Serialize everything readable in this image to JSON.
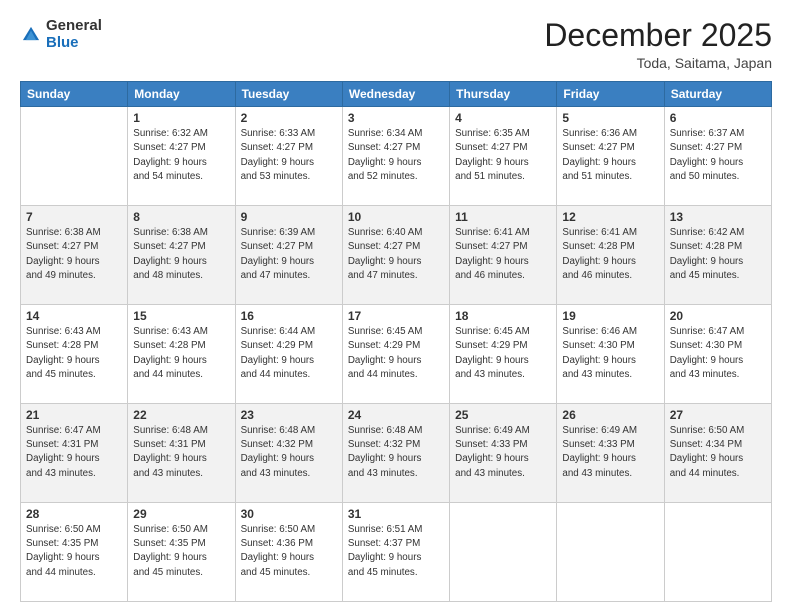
{
  "logo": {
    "general": "General",
    "blue": "Blue"
  },
  "title": "December 2025",
  "location": "Toda, Saitama, Japan",
  "weekdays": [
    "Sunday",
    "Monday",
    "Tuesday",
    "Wednesday",
    "Thursday",
    "Friday",
    "Saturday"
  ],
  "weeks": [
    [
      {
        "day": "",
        "info": ""
      },
      {
        "day": "1",
        "info": "Sunrise: 6:32 AM\nSunset: 4:27 PM\nDaylight: 9 hours\nand 54 minutes."
      },
      {
        "day": "2",
        "info": "Sunrise: 6:33 AM\nSunset: 4:27 PM\nDaylight: 9 hours\nand 53 minutes."
      },
      {
        "day": "3",
        "info": "Sunrise: 6:34 AM\nSunset: 4:27 PM\nDaylight: 9 hours\nand 52 minutes."
      },
      {
        "day": "4",
        "info": "Sunrise: 6:35 AM\nSunset: 4:27 PM\nDaylight: 9 hours\nand 51 minutes."
      },
      {
        "day": "5",
        "info": "Sunrise: 6:36 AM\nSunset: 4:27 PM\nDaylight: 9 hours\nand 51 minutes."
      },
      {
        "day": "6",
        "info": "Sunrise: 6:37 AM\nSunset: 4:27 PM\nDaylight: 9 hours\nand 50 minutes."
      }
    ],
    [
      {
        "day": "7",
        "info": "Sunrise: 6:38 AM\nSunset: 4:27 PM\nDaylight: 9 hours\nand 49 minutes."
      },
      {
        "day": "8",
        "info": "Sunrise: 6:38 AM\nSunset: 4:27 PM\nDaylight: 9 hours\nand 48 minutes."
      },
      {
        "day": "9",
        "info": "Sunrise: 6:39 AM\nSunset: 4:27 PM\nDaylight: 9 hours\nand 47 minutes."
      },
      {
        "day": "10",
        "info": "Sunrise: 6:40 AM\nSunset: 4:27 PM\nDaylight: 9 hours\nand 47 minutes."
      },
      {
        "day": "11",
        "info": "Sunrise: 6:41 AM\nSunset: 4:27 PM\nDaylight: 9 hours\nand 46 minutes."
      },
      {
        "day": "12",
        "info": "Sunrise: 6:41 AM\nSunset: 4:28 PM\nDaylight: 9 hours\nand 46 minutes."
      },
      {
        "day": "13",
        "info": "Sunrise: 6:42 AM\nSunset: 4:28 PM\nDaylight: 9 hours\nand 45 minutes."
      }
    ],
    [
      {
        "day": "14",
        "info": "Sunrise: 6:43 AM\nSunset: 4:28 PM\nDaylight: 9 hours\nand 45 minutes."
      },
      {
        "day": "15",
        "info": "Sunrise: 6:43 AM\nSunset: 4:28 PM\nDaylight: 9 hours\nand 44 minutes."
      },
      {
        "day": "16",
        "info": "Sunrise: 6:44 AM\nSunset: 4:29 PM\nDaylight: 9 hours\nand 44 minutes."
      },
      {
        "day": "17",
        "info": "Sunrise: 6:45 AM\nSunset: 4:29 PM\nDaylight: 9 hours\nand 44 minutes."
      },
      {
        "day": "18",
        "info": "Sunrise: 6:45 AM\nSunset: 4:29 PM\nDaylight: 9 hours\nand 43 minutes."
      },
      {
        "day": "19",
        "info": "Sunrise: 6:46 AM\nSunset: 4:30 PM\nDaylight: 9 hours\nand 43 minutes."
      },
      {
        "day": "20",
        "info": "Sunrise: 6:47 AM\nSunset: 4:30 PM\nDaylight: 9 hours\nand 43 minutes."
      }
    ],
    [
      {
        "day": "21",
        "info": "Sunrise: 6:47 AM\nSunset: 4:31 PM\nDaylight: 9 hours\nand 43 minutes."
      },
      {
        "day": "22",
        "info": "Sunrise: 6:48 AM\nSunset: 4:31 PM\nDaylight: 9 hours\nand 43 minutes."
      },
      {
        "day": "23",
        "info": "Sunrise: 6:48 AM\nSunset: 4:32 PM\nDaylight: 9 hours\nand 43 minutes."
      },
      {
        "day": "24",
        "info": "Sunrise: 6:48 AM\nSunset: 4:32 PM\nDaylight: 9 hours\nand 43 minutes."
      },
      {
        "day": "25",
        "info": "Sunrise: 6:49 AM\nSunset: 4:33 PM\nDaylight: 9 hours\nand 43 minutes."
      },
      {
        "day": "26",
        "info": "Sunrise: 6:49 AM\nSunset: 4:33 PM\nDaylight: 9 hours\nand 43 minutes."
      },
      {
        "day": "27",
        "info": "Sunrise: 6:50 AM\nSunset: 4:34 PM\nDaylight: 9 hours\nand 44 minutes."
      }
    ],
    [
      {
        "day": "28",
        "info": "Sunrise: 6:50 AM\nSunset: 4:35 PM\nDaylight: 9 hours\nand 44 minutes."
      },
      {
        "day": "29",
        "info": "Sunrise: 6:50 AM\nSunset: 4:35 PM\nDaylight: 9 hours\nand 45 minutes."
      },
      {
        "day": "30",
        "info": "Sunrise: 6:50 AM\nSunset: 4:36 PM\nDaylight: 9 hours\nand 45 minutes."
      },
      {
        "day": "31",
        "info": "Sunrise: 6:51 AM\nSunset: 4:37 PM\nDaylight: 9 hours\nand 45 minutes."
      },
      {
        "day": "",
        "info": ""
      },
      {
        "day": "",
        "info": ""
      },
      {
        "day": "",
        "info": ""
      }
    ]
  ]
}
